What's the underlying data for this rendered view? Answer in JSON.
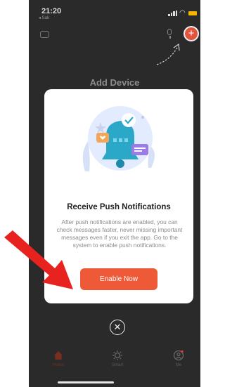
{
  "status_bar": {
    "time": "21:20",
    "back_app": "◂ Sak"
  },
  "header": {
    "title": "Add Device",
    "add_button_label": "+"
  },
  "modal": {
    "title": "Receive Push Notifications",
    "body": "After push notifications are enabled, you can check messages faster, never missing important messages even if you exit the app. Go to the system to enable push notifications.",
    "enable_button": "Enable Now",
    "close_label": "✕"
  },
  "bottom_nav": {
    "items": [
      {
        "label": "Home",
        "icon": "home-icon"
      },
      {
        "label": "Smart",
        "icon": "smart-icon"
      },
      {
        "label": "Me",
        "icon": "me-icon"
      }
    ]
  },
  "colors": {
    "accent": "#ee5a38",
    "background": "#2a2a2a",
    "modal": "#ffffff",
    "annotation_arrow": "#e8231f"
  }
}
